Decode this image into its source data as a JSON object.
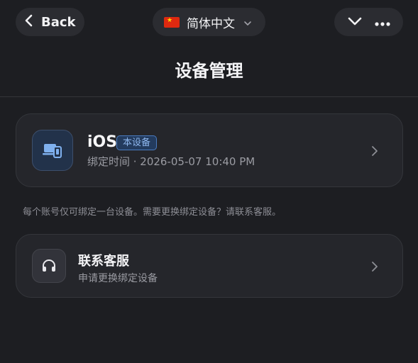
{
  "header": {
    "back_label": "Back",
    "language_label": "简体中文",
    "flag": "china-flag",
    "title": "设备管理"
  },
  "device": {
    "name": "iOS",
    "badge": "本设备",
    "bind_time": "绑定时间 · 2026-05-07 10:40 PM",
    "icon": "devices-icon"
  },
  "note": "每个账号仅可绑定一台设备。需要更换绑定设备？请联系客服。",
  "support": {
    "title": "联系客服",
    "subtitle": "申请更换绑定设备",
    "icon": "headset-icon"
  },
  "colors": {
    "background": "#1d1e22",
    "card": "#25262b",
    "accent": "#8fb8ef",
    "flag_red": "#de2910"
  }
}
